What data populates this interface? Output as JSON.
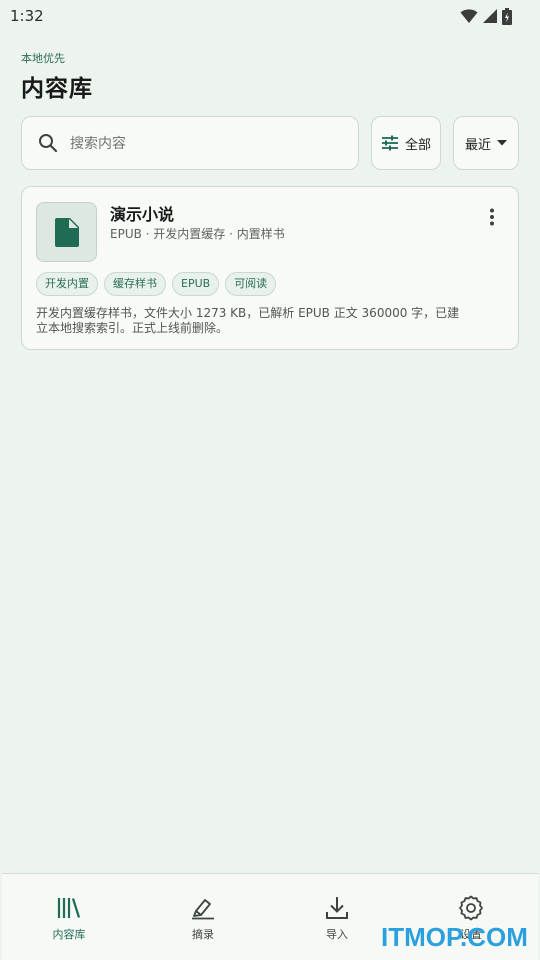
{
  "status_bar": {
    "time": "1:32",
    "icons": [
      "wifi-icon",
      "signal-icon",
      "battery-icon"
    ]
  },
  "header": {
    "subtitle": "本地优先",
    "title": "内容库"
  },
  "search": {
    "placeholder": "搜索内容",
    "icon": "search-icon"
  },
  "filter": {
    "label": "全部",
    "icon": "tune-icon"
  },
  "sort": {
    "label": "最近",
    "icon": "chevron-down-icon"
  },
  "items": [
    {
      "title": "演示小说",
      "meta": "EPUB · 开发内置缓存 · 内置样书",
      "icon": "file-icon",
      "tags": [
        "开发内置",
        "缓存样书",
        "EPUB",
        "可阅读"
      ],
      "description": "开发内置缓存样书，文件大小 1273 KB，已解析 EPUB 正文 360000 字，已建立本地搜索索引。正式上线前删除。"
    }
  ],
  "nav": [
    {
      "label": "内容库",
      "icon": "library-icon",
      "active": true
    },
    {
      "label": "摘录",
      "icon": "highlight-icon",
      "active": false
    },
    {
      "label": "导入",
      "icon": "download-icon",
      "active": false
    },
    {
      "label": "设置",
      "icon": "settings-icon",
      "active": false
    }
  ],
  "watermark": "ITMOP.COM",
  "colors": {
    "accent": "#1f6b53",
    "background": "#edf3ee",
    "surface": "#f8faf8",
    "watermark": "#2aa0de"
  }
}
